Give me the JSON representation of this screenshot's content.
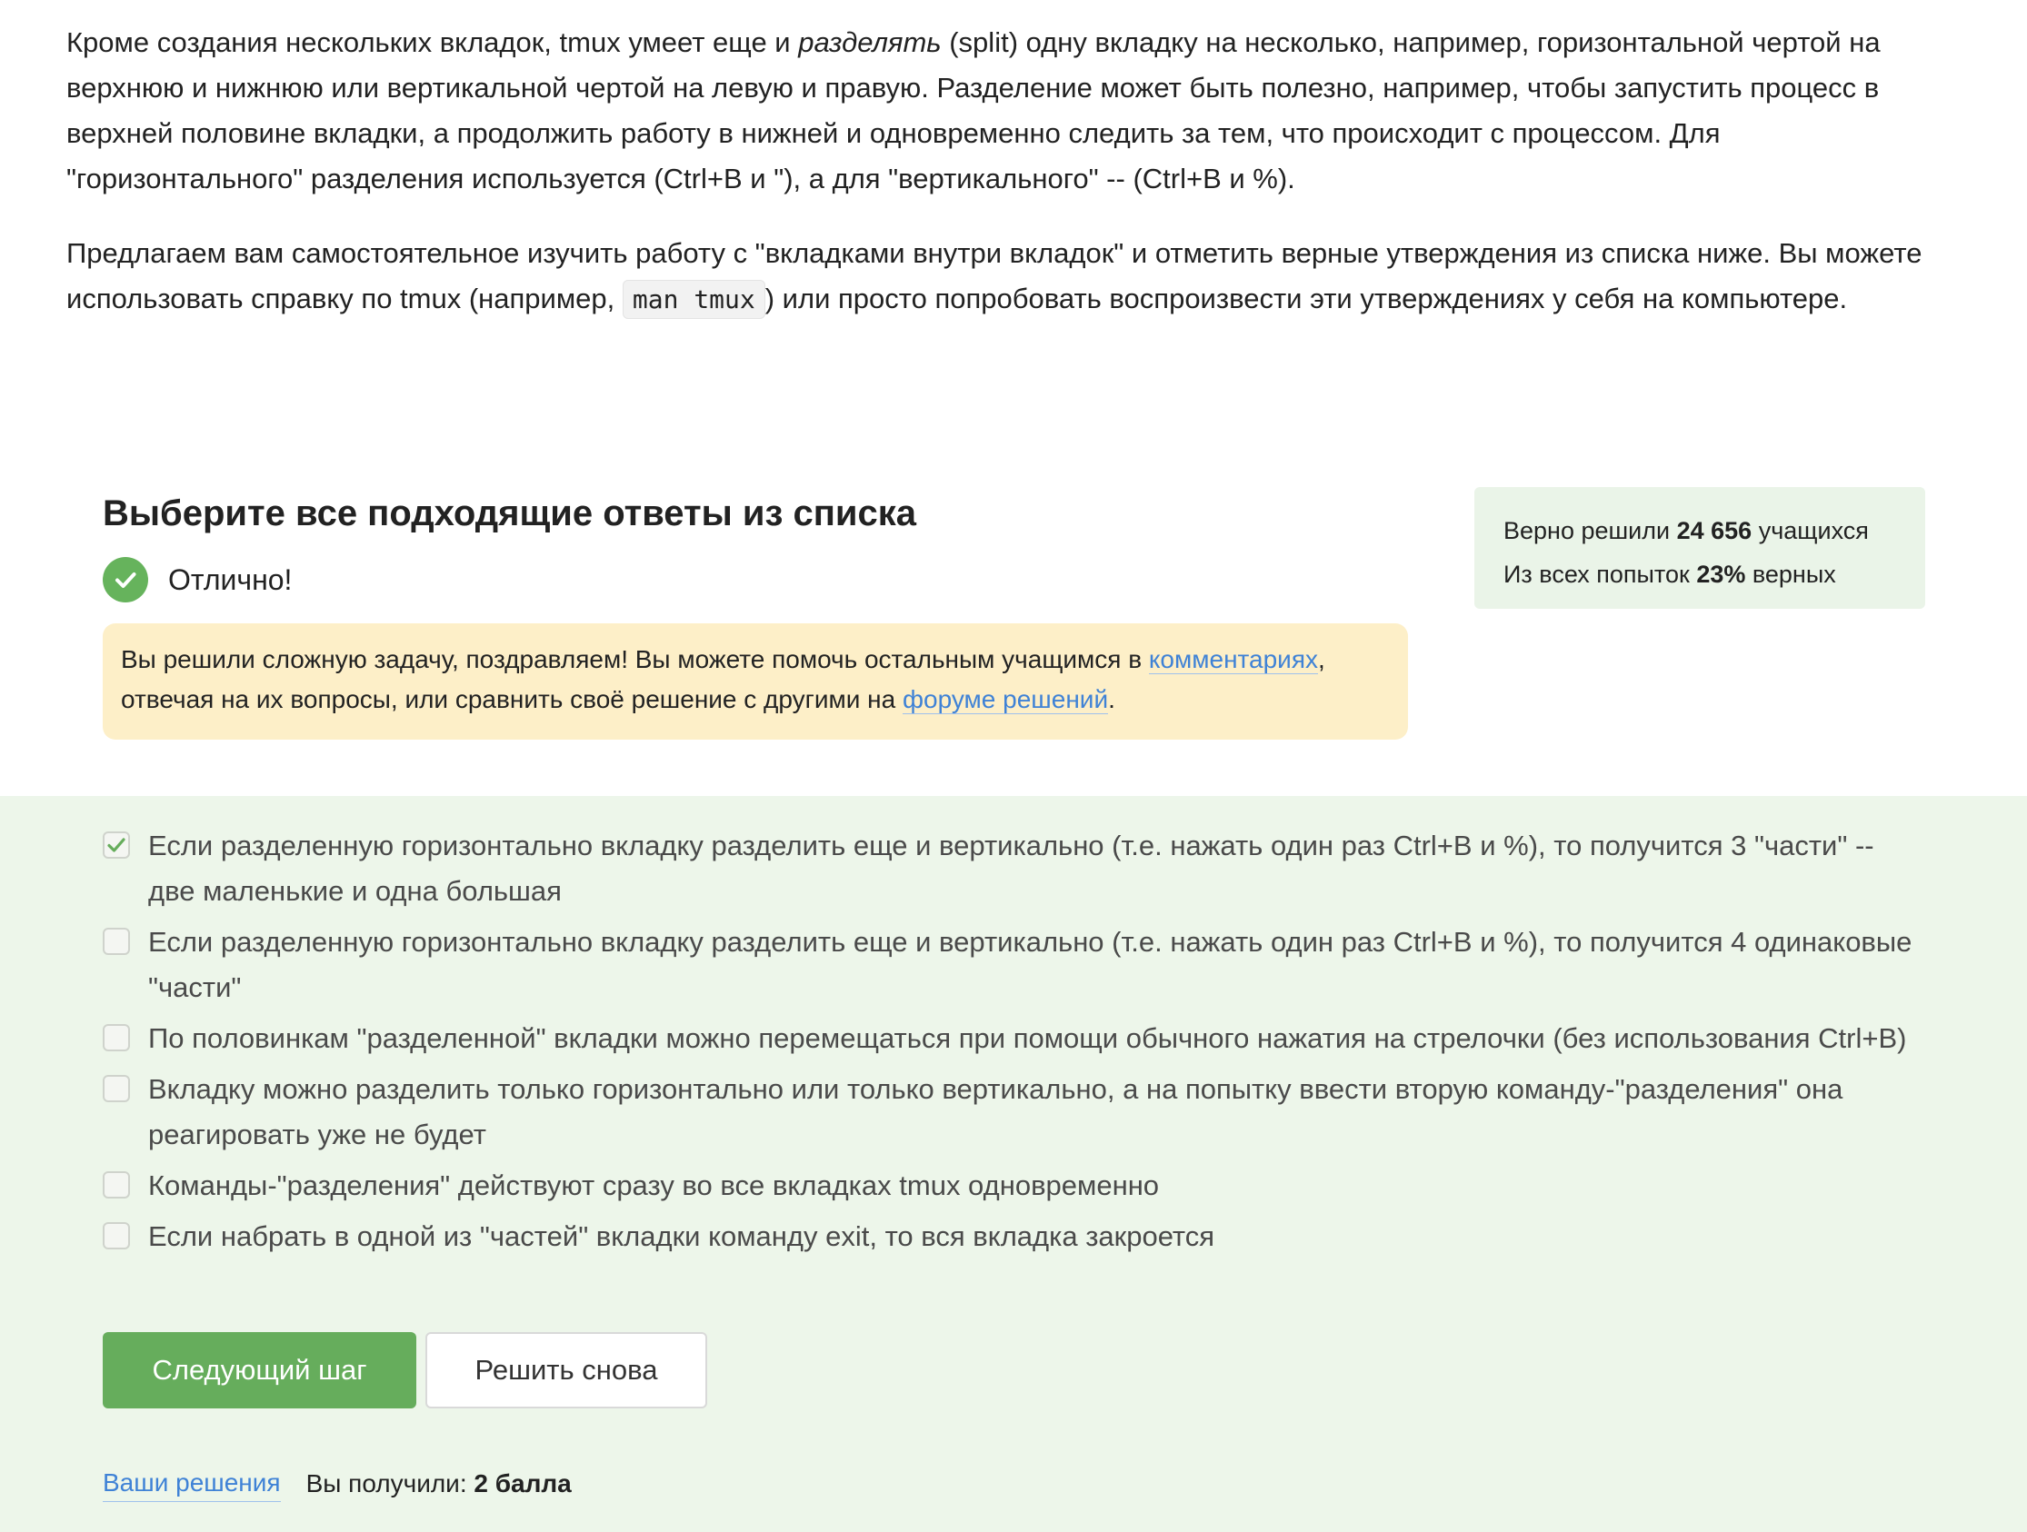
{
  "lesson": {
    "p1_part1": "Кроме создания нескольких вкладок, tmux умеет еще и ",
    "p1_em": "разделять",
    "p1_part2": " (split) одну вкладку на несколько, например, горизонтальной чертой на верхнюю и нижнюю или вертикальной чертой на левую и правую. Разделение может быть полезно, например, чтобы запустить процесс в верхней половине вкладки, а продолжить работу в нижней и одновременно следить за тем, что происходит с процессом. Для \"горизонтального\" разделения используется (Ctrl+B и \"), а для \"вертикального\" -- (Ctrl+B и %).",
    "p2_part1": "Предлагаем вам самостоятельное изучить работу с \"вкладками внутри вкладок\" и отметить верные утверждения из списка ниже. Вы можете использовать справку по tmux (например, ",
    "p2_code": "man tmux",
    "p2_part2": ") или просто попробовать воспроизвести эти утверждениях у себя на компьютере."
  },
  "quiz": {
    "title": "Выберите все подходящие ответы из списка",
    "status": "Отлично!",
    "hint_part1": "Вы решили сложную задачу, поздравляем! Вы можете помочь остальным учащимся в ",
    "hint_link1": "комментариях",
    "hint_part2": ", отвечая на их вопросы, или сравнить своё решение с другими на ",
    "hint_link2": "форуме решений",
    "hint_part3": "."
  },
  "stats": {
    "solved_label": "Верно решили ",
    "solved_count": "24 656",
    "solved_suffix": " учащихся",
    "attempts_label": "Из всех попыток ",
    "attempts_percent": "23%",
    "attempts_suffix": " верных"
  },
  "options": [
    {
      "text": "Если разделенную горизонтально вкладку разделить еще и вертикально (т.е. нажать один раз Ctrl+B и %), то получится 3 \"части\" -- две маленькие и одна большая",
      "checked": true
    },
    {
      "text": "Если разделенную горизонтально вкладку разделить еще и вертикально (т.е. нажать один раз Ctrl+B и %), то получится 4 одинаковые \"части\"",
      "checked": false
    },
    {
      "text": "По половинкам \"разделенной\" вкладки можно перемещаться при помощи обычного нажатия на стрелочки (без использования Ctrl+B)",
      "checked": false
    },
    {
      "text": "Вкладку можно разделить только горизонтально или только вертикально, а на попытку ввести вторую команду-\"разделения\" она реагировать уже не будет",
      "checked": false
    },
    {
      "text": "Команды-\"разделения\" действуют сразу во все вкладках tmux одновременно",
      "checked": false
    },
    {
      "text": "Если набрать в одной из \"частей\" вкладки команду exit, то вся вкладка закроется",
      "checked": false
    }
  ],
  "buttons": {
    "next": "Следующий шаг",
    "retry": "Решить снова"
  },
  "footer": {
    "solutions_link": "Ваши решения",
    "score_label": "Вы получили: ",
    "score_value": "2 балла"
  },
  "colors": {
    "accent_green": "#66ad5c",
    "answers_bg": "#edf6ea",
    "hint_bg": "#fdefc8",
    "link": "#3f82d6"
  },
  "icons": {
    "success": "check-circle-icon",
    "checked": "checkmark-icon"
  }
}
